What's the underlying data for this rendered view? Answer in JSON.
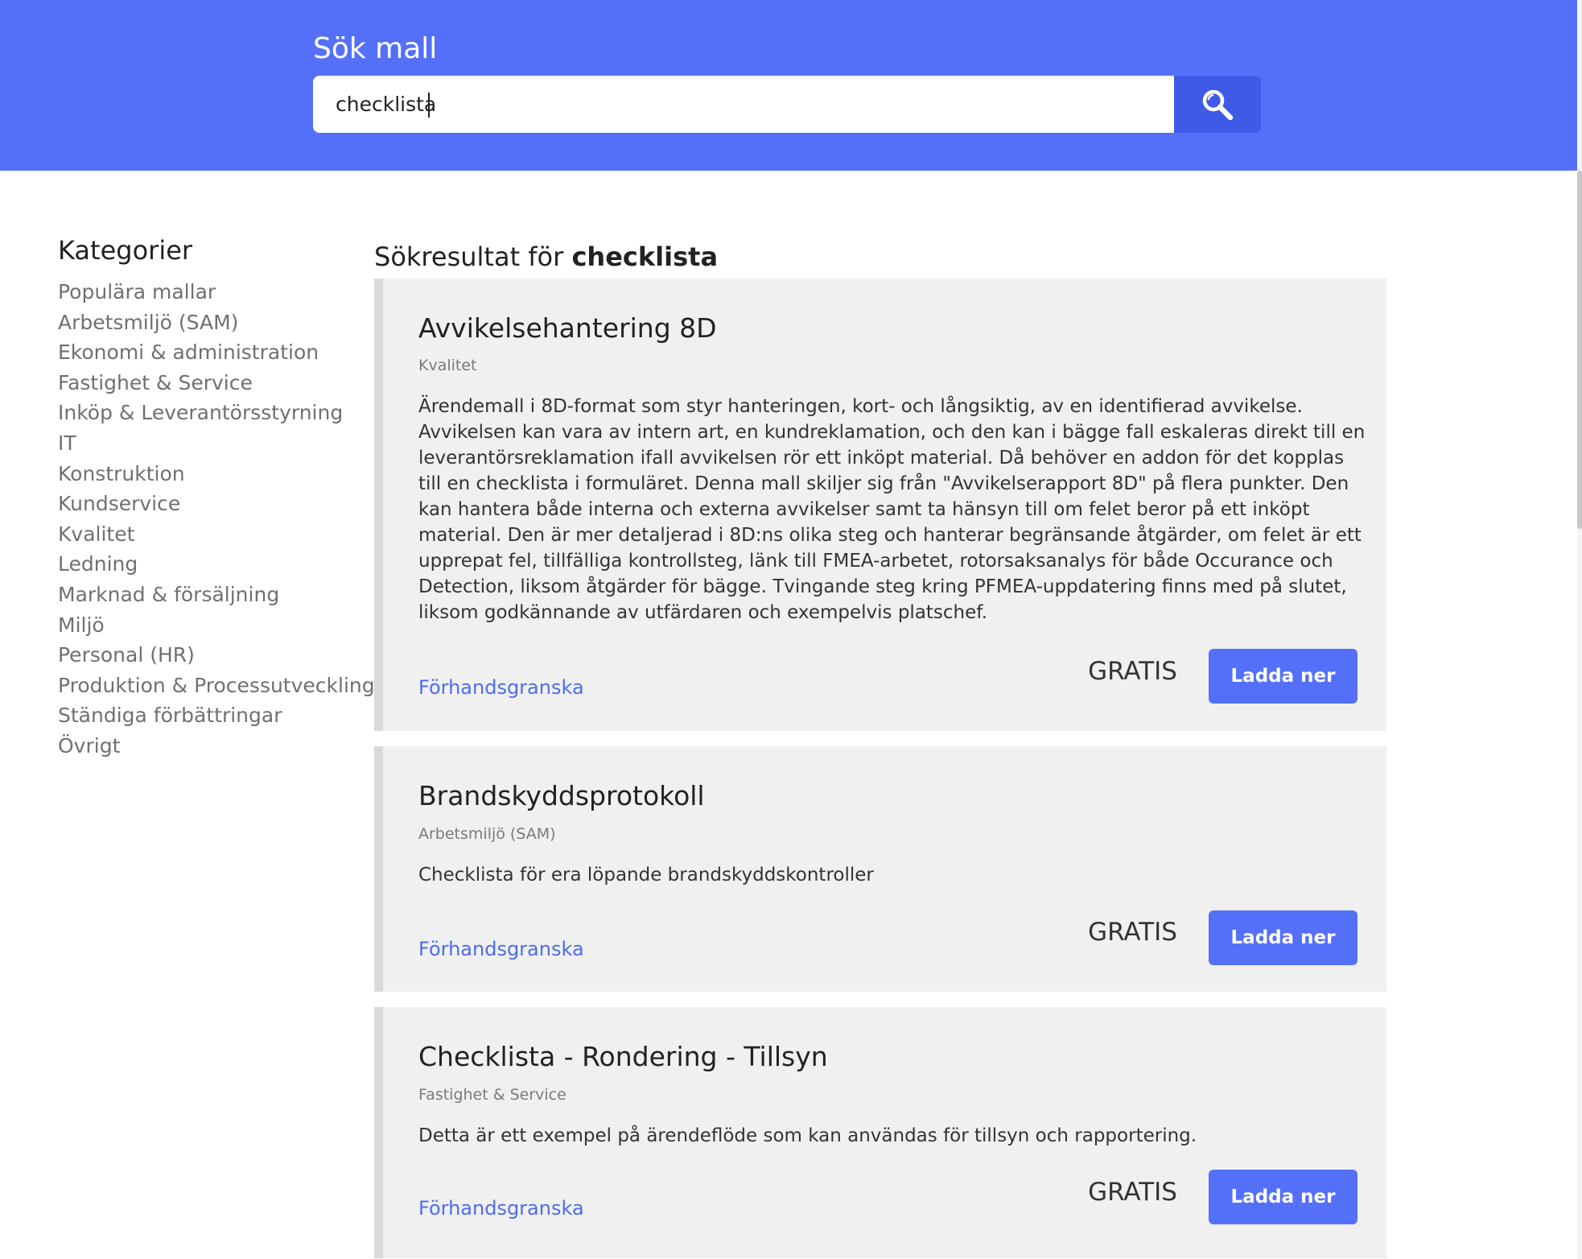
{
  "search": {
    "title": "Sök mall",
    "value": "checklista"
  },
  "sidebar": {
    "title": "Kategorier",
    "items": [
      "Populära mallar",
      "Arbetsmiljö (SAM)",
      "Ekonomi & administration",
      "Fastighet & Service",
      "Inköp & Leverantörsstyrning",
      "IT",
      "Konstruktion",
      "Kundservice",
      "Kvalitet",
      "Ledning",
      "Marknad & försäljning",
      "Miljö",
      "Personal (HR)",
      "Produktion & Processutveckling",
      "Ständiga förbättringar",
      "Övrigt"
    ]
  },
  "results": {
    "heading_prefix": "Sökresultat för",
    "query": "checklista",
    "items": [
      {
        "title": "Avvikelsehantering 8D",
        "category": "Kvalitet",
        "description": "Ärendemall i 8D-format som styr hanteringen, kort- och långsiktig, av en identifierad avvikelse. Avvikelsen kan vara av intern art, en kundreklamation, och den kan i bägge fall eskaleras direkt till en leverantörsreklamation ifall avvikelsen rör ett inköpt material. Då behöver en addon för det kopplas till en checklista i formuläret. Denna mall skiljer sig från \"Avvikelserapport 8D\" på flera punkter. Den kan hantera både interna och externa avvikelser samt ta hänsyn till om felet beror på ett inköpt material. Den är mer detaljerad i 8D:ns olika steg och hanterar begränsande åtgärder, om felet är ett upprepat fel, tillfälliga kontrollsteg, länk till FMEA-arbetet, rotorsaksanalys för både Occurance och Detection, liksom åtgärder för bägge. Tvingande steg kring PFMEA-uppdatering finns med på slutet, liksom godkännande av utfärdaren och exempelvis platschef.",
        "preview_label": "Förhandsgranska",
        "price": "GRATIS",
        "download_label": "Ladda ner"
      },
      {
        "title": "Brandskyddsprotokoll",
        "category": "Arbetsmiljö (SAM)",
        "description": "Checklista för era löpande brandskyddskontroller",
        "preview_label": "Förhandsgranska",
        "price": "GRATIS",
        "download_label": "Ladda ner"
      },
      {
        "title": "Checklista - Rondering - Tillsyn",
        "category": "Fastighet & Service",
        "description": "Detta är ett exempel på ärendeflöde som kan användas för tillsyn och rapportering.",
        "preview_label": "Förhandsgranska",
        "price": "GRATIS",
        "download_label": "Ladda ner"
      }
    ]
  },
  "colors": {
    "header_bg": "#5570f8",
    "search_button_bg": "#3f5ae6",
    "link": "#4e6cf0",
    "card_bg": "#f0f0f0",
    "card_border": "#dadada"
  },
  "icons": {
    "search_button": "search-icon"
  }
}
